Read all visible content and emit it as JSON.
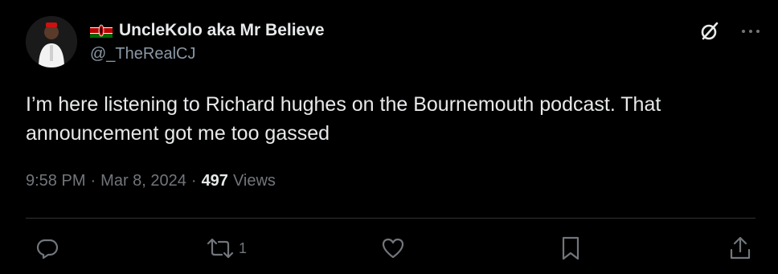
{
  "author": {
    "display_name": "UncleKolo aka Mr Believe",
    "handle": "@_TheRealCJ",
    "flag_icon": "kenya-flag-icon",
    "avatar_icon": "user-avatar"
  },
  "tweet": {
    "text": "I’m here listening to Richard hughes on the Bournemouth podcast. That announcement got me too gassed"
  },
  "meta": {
    "time": "9:58 PM",
    "separator": "·",
    "date": "Mar 8, 2024",
    "views_count": "497",
    "views_label": "Views"
  },
  "actions": {
    "reply_count": "",
    "retweet_count": "1",
    "like_count": "",
    "bookmark_count": ""
  },
  "colors": {
    "background": "#000000",
    "text_primary": "#e7e9ea",
    "text_secondary": "#71767b",
    "divider": "#2f3336"
  },
  "icons": {
    "grok": "grok-icon",
    "more": "more-icon",
    "reply": "reply-icon",
    "retweet": "retweet-icon",
    "like": "heart-icon",
    "bookmark": "bookmark-icon",
    "share": "share-icon"
  }
}
